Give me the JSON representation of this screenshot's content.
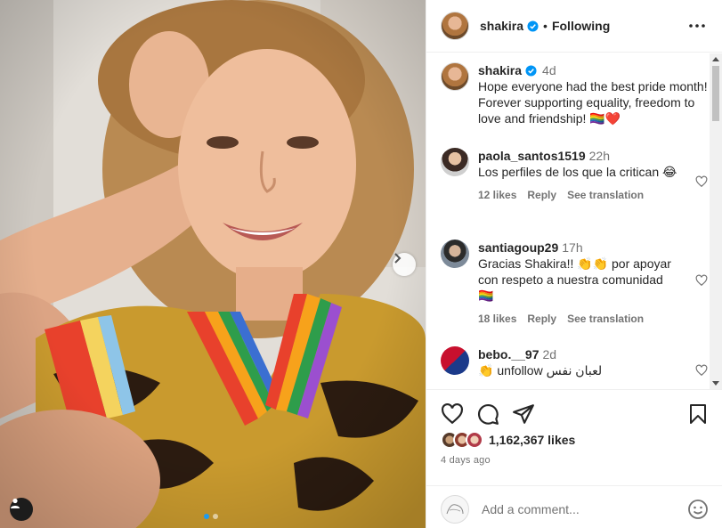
{
  "post": {
    "author": "shakira",
    "follow_status": "Following",
    "separator": "•"
  },
  "caption": {
    "username": "shakira",
    "time": "4d",
    "text": "Hope everyone had the best pride month! Forever supporting equality, freedom to love and friendship! 🏳️‍🌈❤️"
  },
  "comments": [
    {
      "username": "paola_santos1519",
      "time": "22h",
      "text": "Los perfiles de los que la critican 😂",
      "likes": "12 likes",
      "reply": "Reply",
      "translate": "See translation"
    },
    {
      "username": "santiagoup29",
      "time": "17h",
      "text": "Gracias Shakira!! 👏👏 por apoyar con respeto a nuestra comunidad 🏳️‍🌈",
      "likes": "18 likes",
      "reply": "Reply",
      "translate": "See translation"
    },
    {
      "username": "bebo.__97",
      "time": "2d",
      "text": "👏 unfollow لعبان نفس"
    }
  ],
  "stats": {
    "likes": "1,162,367 likes",
    "posted": "4 days ago"
  },
  "composer": {
    "placeholder": "Add a comment..."
  },
  "carousel": {
    "current_slide": 1,
    "total_slides": 2
  },
  "colors": {
    "verified": "#0095f6",
    "active_dot": "#1d9bf0",
    "text": "#262626",
    "muted": "#737373"
  },
  "icons": [
    "verified-badge-icon",
    "more-options-icon",
    "heart-icon",
    "comment-icon",
    "share-icon",
    "bookmark-icon",
    "emoji-icon",
    "user-tag-icon",
    "chevron-right-icon"
  ]
}
